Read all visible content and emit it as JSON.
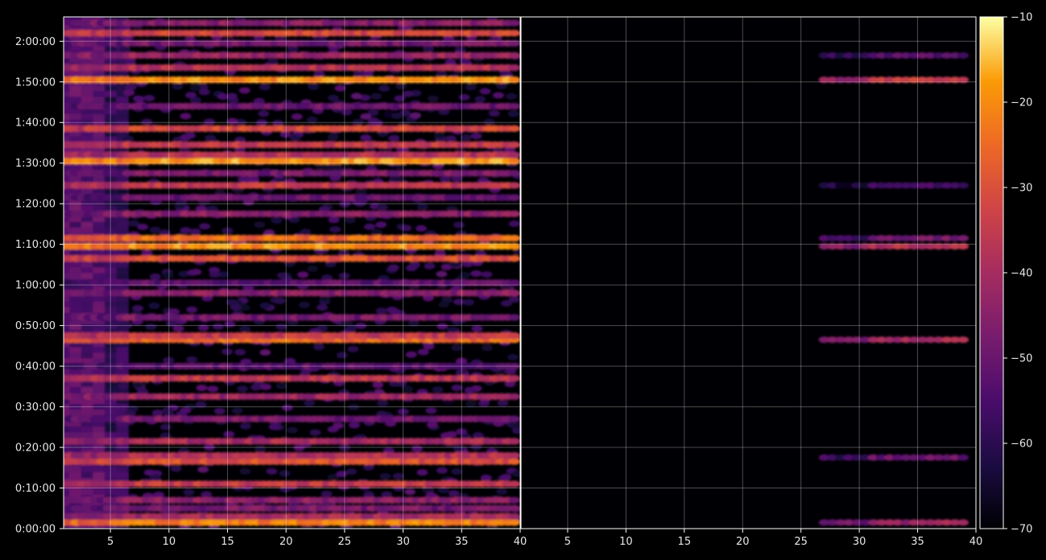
{
  "chart_data": {
    "type": "heatmap",
    "colormap": "inferno",
    "background": "#000000",
    "grid": true,
    "panels": [
      {
        "x_range": [
          1,
          40
        ],
        "x_ticks": [
          5,
          10,
          15,
          20,
          25,
          30,
          35,
          40
        ],
        "activity": "full"
      },
      {
        "x_range": [
          1,
          40
        ],
        "x_ticks": [
          5,
          10,
          15,
          20,
          25,
          30,
          35,
          40
        ],
        "activity": "sparse"
      }
    ],
    "y_axis": {
      "range_minutes": [
        0,
        126
      ],
      "ticks": [
        "0:00:00",
        "0:10:00",
        "0:20:00",
        "0:30:00",
        "0:40:00",
        "0:50:00",
        "1:00:00",
        "1:10:00",
        "1:20:00",
        "1:30:00",
        "1:40:00",
        "1:50:00",
        "2:00:00"
      ]
    },
    "colorbar": {
      "range": [
        -70,
        -10
      ],
      "ticks": [
        "-10",
        "-20",
        "-30",
        "-40",
        "-50",
        "-60",
        "-70"
      ]
    },
    "bands": [
      {
        "t_min": 1.5,
        "level": -22
      },
      {
        "t_min": 3.0,
        "level": -40
      },
      {
        "t_min": 5.0,
        "level": -48
      },
      {
        "t_min": 7.0,
        "level": -45
      },
      {
        "t_min": 11.0,
        "level": -35
      },
      {
        "t_min": 16.5,
        "level": -30
      },
      {
        "t_min": 18.0,
        "level": -38
      },
      {
        "t_min": 21.5,
        "level": -40
      },
      {
        "t_min": 27.0,
        "level": -48
      },
      {
        "t_min": 32.5,
        "level": -42
      },
      {
        "t_min": 37.0,
        "level": -36
      },
      {
        "t_min": 40.0,
        "level": -52
      },
      {
        "t_min": 46.5,
        "level": -25
      },
      {
        "t_min": 47.5,
        "level": -35
      },
      {
        "t_min": 52.0,
        "level": -48
      },
      {
        "t_min": 58.0,
        "level": -45
      },
      {
        "t_min": 60.5,
        "level": -52
      },
      {
        "t_min": 66.5,
        "level": -30
      },
      {
        "t_min": 69.5,
        "level": -20
      },
      {
        "t_min": 71.5,
        "level": -25
      },
      {
        "t_min": 77.5,
        "level": -45
      },
      {
        "t_min": 81.5,
        "level": -50
      },
      {
        "t_min": 84.5,
        "level": -35
      },
      {
        "t_min": 87.5,
        "level": -48
      },
      {
        "t_min": 90.5,
        "level": -18
      },
      {
        "t_min": 92.0,
        "level": -38
      },
      {
        "t_min": 94.5,
        "level": -35
      },
      {
        "t_min": 98.5,
        "level": -32
      },
      {
        "t_min": 104.0,
        "level": -50
      },
      {
        "t_min": 110.5,
        "level": -20
      },
      {
        "t_min": 113.5,
        "level": -38
      },
      {
        "t_min": 116.5,
        "level": -42
      },
      {
        "t_min": 119.5,
        "level": -48
      },
      {
        "t_min": 122.0,
        "level": -32
      },
      {
        "t_min": 124.5,
        "level": -45
      }
    ],
    "right_panel_bands": [
      {
        "t_min": 1.5,
        "level": -42
      },
      {
        "t_min": 17.5,
        "level": -50
      },
      {
        "t_min": 46.5,
        "level": -40
      },
      {
        "t_min": 69.5,
        "level": -38
      },
      {
        "t_min": 71.5,
        "level": -48
      },
      {
        "t_min": 84.5,
        "level": -55
      },
      {
        "t_min": 110.5,
        "level": -35
      },
      {
        "t_min": 116.5,
        "level": -52
      }
    ]
  }
}
